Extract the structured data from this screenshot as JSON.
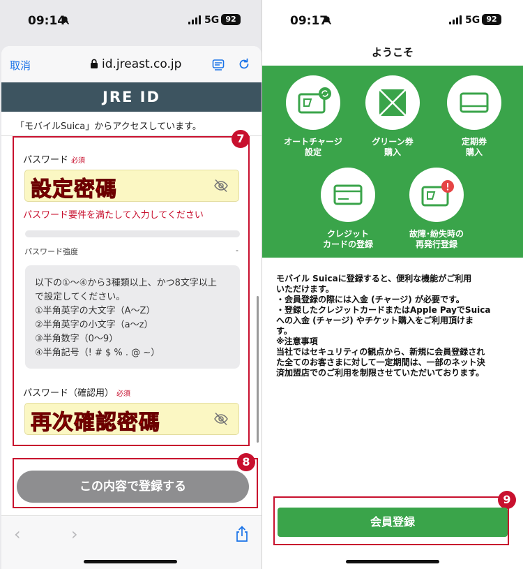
{
  "left": {
    "status": {
      "time": "09:14",
      "network": "5G",
      "battery": "92"
    },
    "browser": {
      "cancel_label": "取消",
      "url": "id.jreast.co.jp"
    },
    "brand": "JRE ID",
    "access_notice": "「モバイルSuica」からアクセスしています。",
    "password": {
      "label": "パスワード",
      "required": "必須",
      "value": "設定密碼",
      "error": "パスワード要件を満たして入力してください",
      "strength_label": "パスワード強度",
      "strength_value": "-",
      "rules": [
        "以下の①～④から3種類以上、かつ8文字以上",
        "で設定してください。",
        "①半角英字の大文字（A～Z）",
        "②半角英字の小文字（a～z）",
        "③半角数字（0～9）",
        "④半角記号（! # $ % . @ ~）"
      ]
    },
    "confirm": {
      "label": "パスワード（確認用）",
      "required": "必須",
      "value": "再次確認密碼"
    },
    "submit_label": "この内容で登録する",
    "toolbar": {
      "back": "‹",
      "forward": "›"
    },
    "badges": {
      "seven": "7",
      "eight": "8"
    }
  },
  "right": {
    "status": {
      "time": "09:17",
      "network": "5G",
      "battery": "92"
    },
    "title": "ようこそ",
    "features": [
      {
        "line1": "オートチャージ",
        "line2": "設定",
        "icon": "auto-charge-card-icon"
      },
      {
        "line1": "グリーン券",
        "line2": "購入",
        "icon": "green-ticket-icon"
      },
      {
        "line1": "定期券",
        "line2": "購入",
        "icon": "commuter-pass-icon"
      },
      {
        "line1": "クレジット",
        "line2": "カードの登録",
        "icon": "credit-card-icon"
      },
      {
        "line1": "故障･紛失時の",
        "line2": "再発行登録",
        "icon": "reissue-card-icon"
      }
    ],
    "description": [
      "モバイル Suicaに登録すると、便利な機能がご利用",
      "いただけます。",
      "・会員登録の際には入金 (チャージ) が必要です。",
      "・登録したクレジットカードまたはApple PayでSuica",
      "への入金 (チャージ) やチケット購入をご利用頂けま",
      "す。",
      "※注意事項",
      "当社ではセキュリティの観点から、新規に会員登録され",
      "た全てのお客さまに対して一定期間は、一部のネット決",
      "済加盟店でのご利用を制限させていただいております。"
    ],
    "member_button": "会員登録",
    "badge_nine": "9"
  },
  "colors": {
    "accent_green": "#3aa44a",
    "annotation_red": "#c8102e",
    "header_slate": "#3d5460",
    "link_blue": "#1a73e8"
  }
}
